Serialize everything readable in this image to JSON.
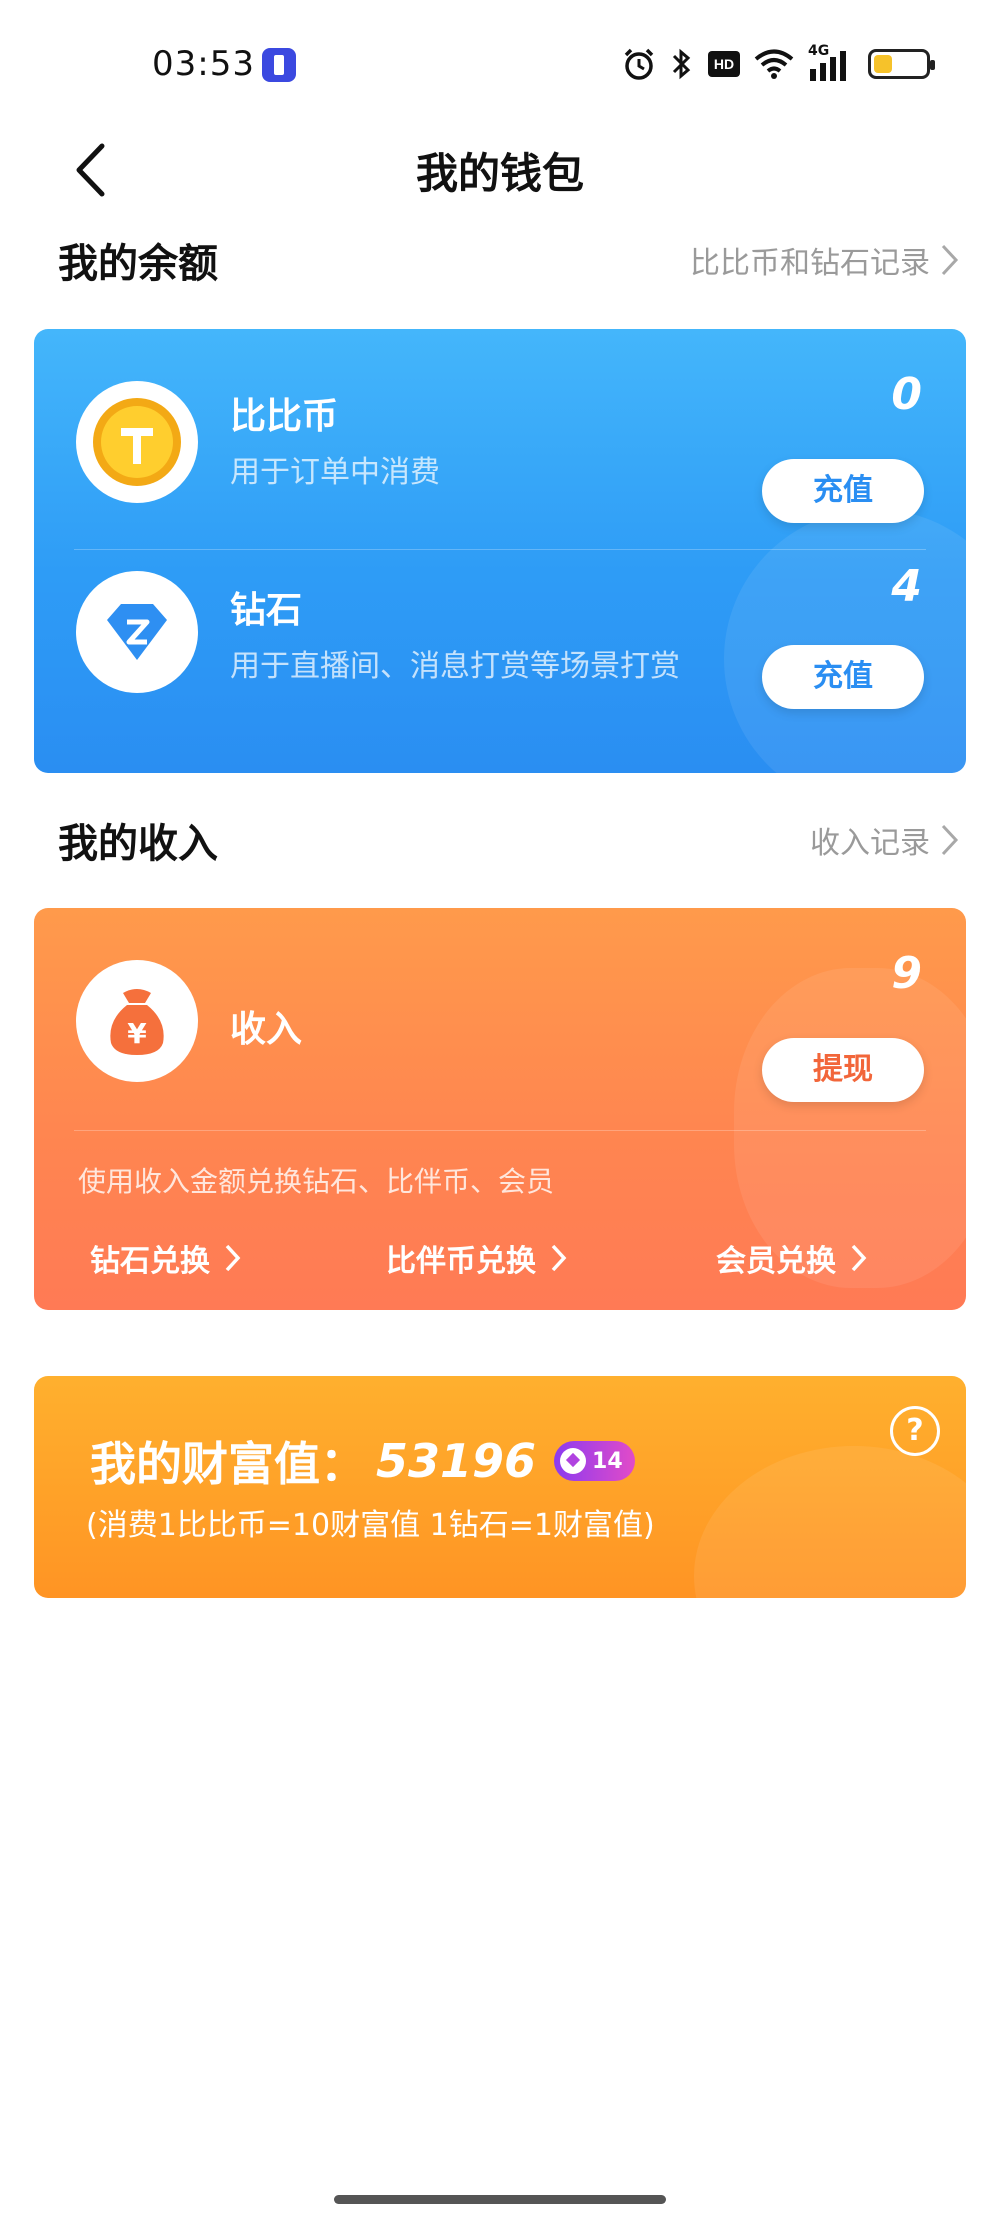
{
  "status_bar": {
    "time": "03:53",
    "network": "4G",
    "hd": "HD"
  },
  "nav": {
    "title": "我的钱包",
    "back_icon": "chevron-left-icon"
  },
  "balance_section": {
    "title": "我的余额",
    "link": "比比币和钻石记录"
  },
  "balance_card": {
    "color": "#2e9cf6",
    "rows": [
      {
        "name": "比比币",
        "desc": "用于订单中消费",
        "value": "0",
        "button": "充值",
        "icon": "gold-coin-icon"
      },
      {
        "name": "钻石",
        "desc": "用于直播间、消息打赏等场景打赏",
        "value": "4",
        "button": "充值",
        "icon": "diamond-icon"
      }
    ]
  },
  "income_section": {
    "title": "我的收入",
    "link": "收入记录"
  },
  "income_card": {
    "color": "#ff8650",
    "name": "收入",
    "value": "9",
    "button": "提现",
    "icon": "money-bag-icon",
    "tip": "使用收入金额兑换钻石、比伴币、会员",
    "exchanges": [
      "钻石兑换",
      "比伴币兑换",
      "会员兑换"
    ]
  },
  "wealth_card": {
    "color": "#ffa128",
    "label": "我的财富值：",
    "value": "53196",
    "level": "14",
    "note": "(消费1比比币=10财富值 1钻石=1财富值)",
    "help": "?"
  }
}
